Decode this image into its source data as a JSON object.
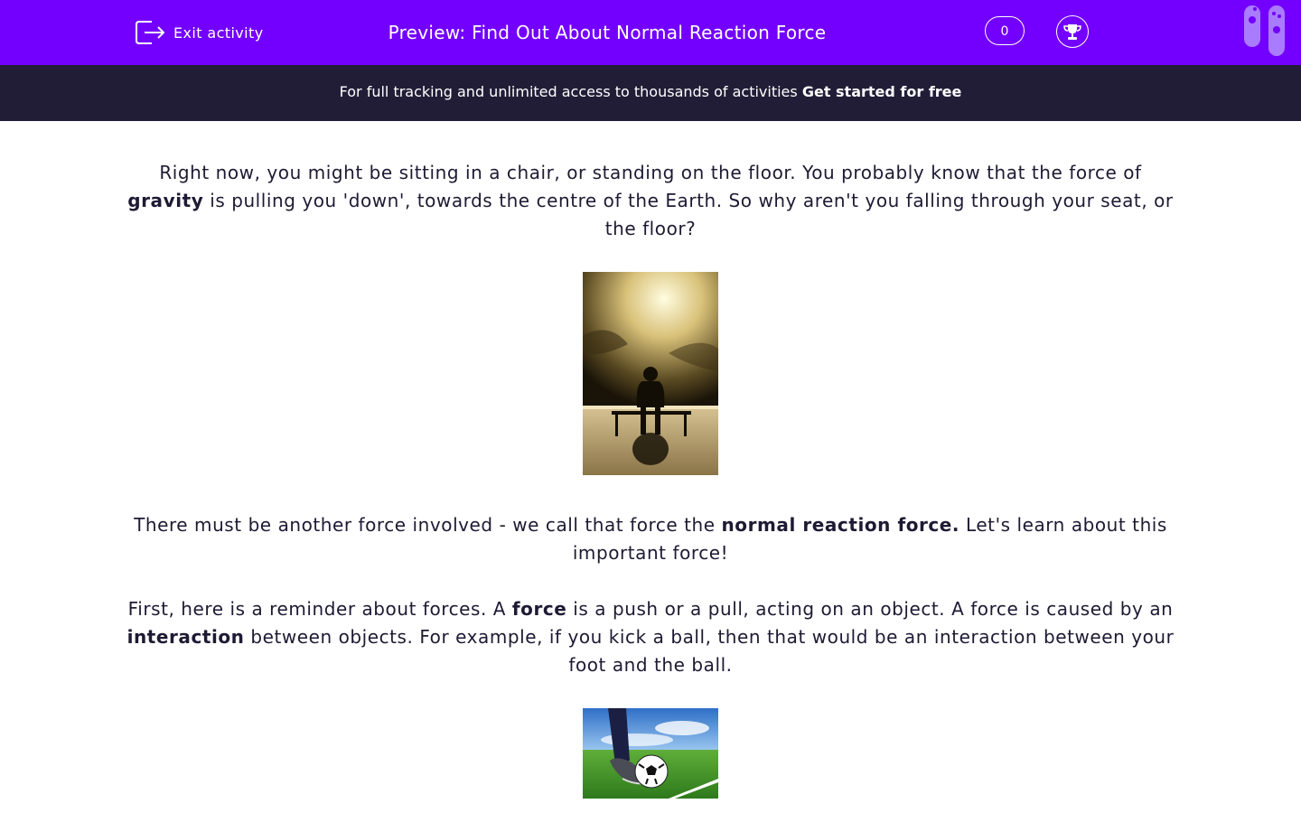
{
  "header": {
    "exit_label": "Exit activity",
    "title": "Preview: Find Out About Normal Reaction Force",
    "score": "0",
    "icons": {
      "exit": "exit-icon",
      "trophy": "trophy-icon",
      "tubes": "test-tubes-icon"
    }
  },
  "banner": {
    "text": "For full tracking and unlimited access to thousands of activities ",
    "cta": "Get started for free"
  },
  "content": {
    "p1_a": "Right now, you might be sitting in a chair, or standing on the floor. You probably know that the force of ",
    "p1_b": "gravity",
    "p1_c": " is pulling you 'down', towards the centre of the Earth. So why aren't you falling through your seat, or the floor?",
    "p2_a": "There must be another force involved - we call that force the ",
    "p2_b": "normal reaction force.",
    "p2_c": " Let's learn about this important force!",
    "p3_a": "First, here is a reminder about forces. A ",
    "p3_b": "force",
    "p3_c": " is a push or a pull, acting on an object. A force is caused by an ",
    "p3_d": "interaction",
    "p3_e": " between objects. For example, if you kick a ball, then that would be an interaction between your foot and the ball."
  },
  "colors": {
    "header_bg": "#7300ff",
    "banner_bg": "#221d37",
    "text": "#1e1a33"
  }
}
